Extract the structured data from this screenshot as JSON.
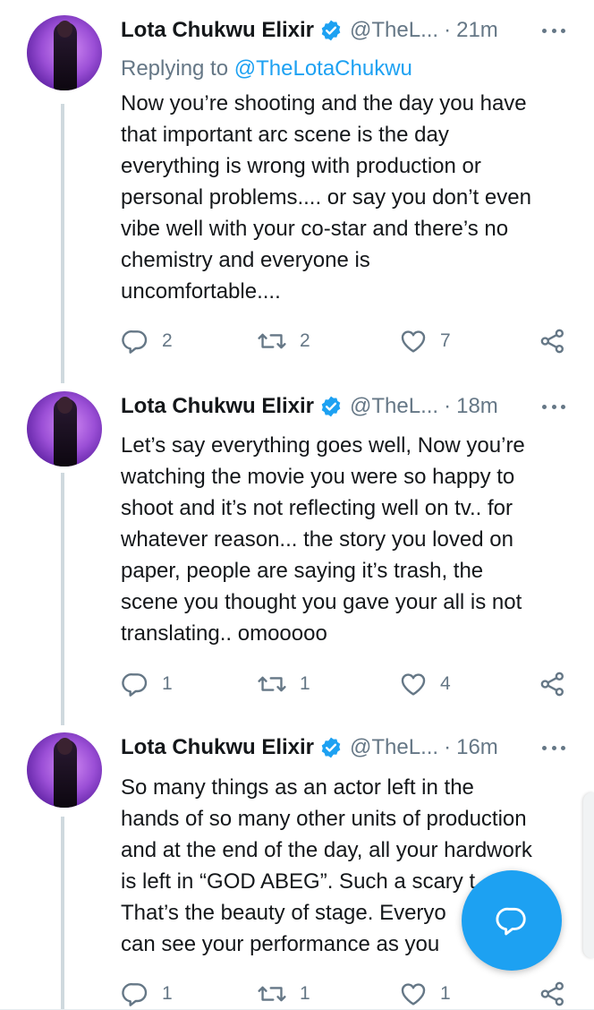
{
  "tweets": [
    {
      "name": "Lota Chukwu Elixir",
      "handle": "@TheL...",
      "separator": "·",
      "time": "21m",
      "replying_prefix": "Replying to ",
      "replying_handle": "@TheLotaChukwu",
      "lines": [
        "Now you’re shooting and the day you have",
        "that important arc scene is the day",
        "everything is wrong with production or",
        "personal problems.... or say you don’t even",
        "vibe well with your co-star and there’s no",
        "chemistry and everyone is",
        "uncomfortable...."
      ],
      "replies": "2",
      "retweets": "2",
      "likes": "7"
    },
    {
      "name": "Lota Chukwu Elixir",
      "handle": "@TheL...",
      "separator": "·",
      "time": "18m",
      "lines": [
        "Let’s say everything goes well, Now you’re",
        "watching the movie you were so happy to",
        "shoot and it’s not reflecting well on tv.. for",
        "whatever reason... the story you loved on",
        "paper, people are saying it’s trash, the",
        "scene you thought you gave your all is not",
        "translating.. omooooo"
      ],
      "replies": "1",
      "retweets": "1",
      "likes": "4"
    },
    {
      "name": "Lota Chukwu Elixir",
      "handle": "@TheL...",
      "separator": "·",
      "time": "16m",
      "lines": [
        "So many things as an actor left in the",
        "hands of so many other units of production",
        "and at the end of the day, all your hardwork",
        "is left in “GOD ABEG”. Such a scary t",
        "That’s the beauty of stage. Everyo",
        "can see your performance as you"
      ],
      "replies": "1",
      "retweets": "1",
      "likes": "1"
    }
  ],
  "icons": {
    "verified": "verified-badge-icon",
    "more": "more-options-icon",
    "reply": "reply-icon",
    "retweet": "retweet-icon",
    "like": "heart-icon",
    "share": "share-icon",
    "compose": "compose-reply-icon"
  },
  "colors": {
    "accent": "#1da1f2",
    "text": "#14171a",
    "secondary": "#657786",
    "thread_line": "#cfd9de"
  }
}
